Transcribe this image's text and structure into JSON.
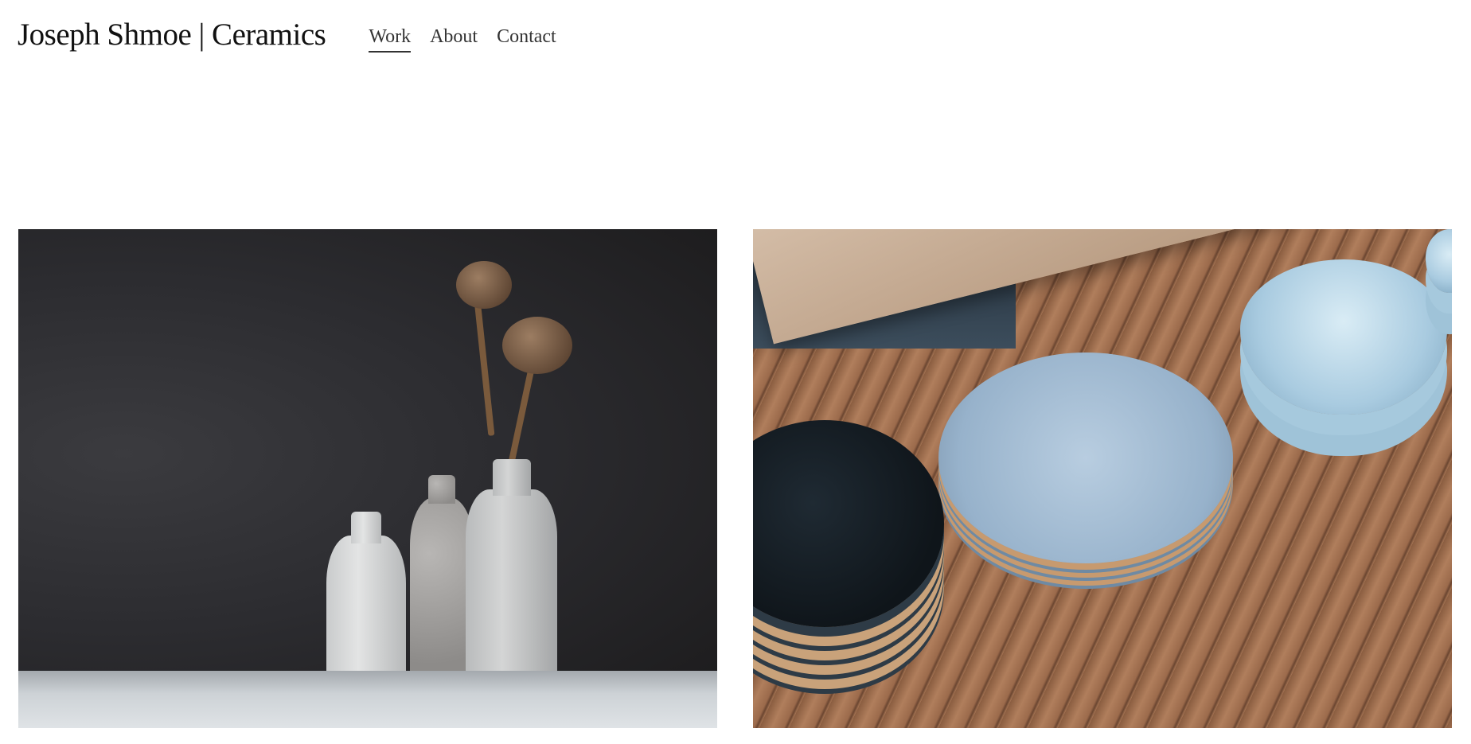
{
  "header": {
    "site_title": "Joseph Shmoe | Ceramics",
    "nav": [
      {
        "label": "Work",
        "active": true
      },
      {
        "label": "About",
        "active": false
      },
      {
        "label": "Contact",
        "active": false
      }
    ]
  },
  "gallery": {
    "items": [
      {
        "image": "white ceramic bottles with dried poppy pods on dark background",
        "caption": ""
      },
      {
        "image": "stacked blue and black ceramic plates and bowls on wooden shelf",
        "caption": ""
      }
    ]
  },
  "colors": {
    "background": "#ffffff",
    "text": "#111111",
    "nav_text": "#333333"
  }
}
